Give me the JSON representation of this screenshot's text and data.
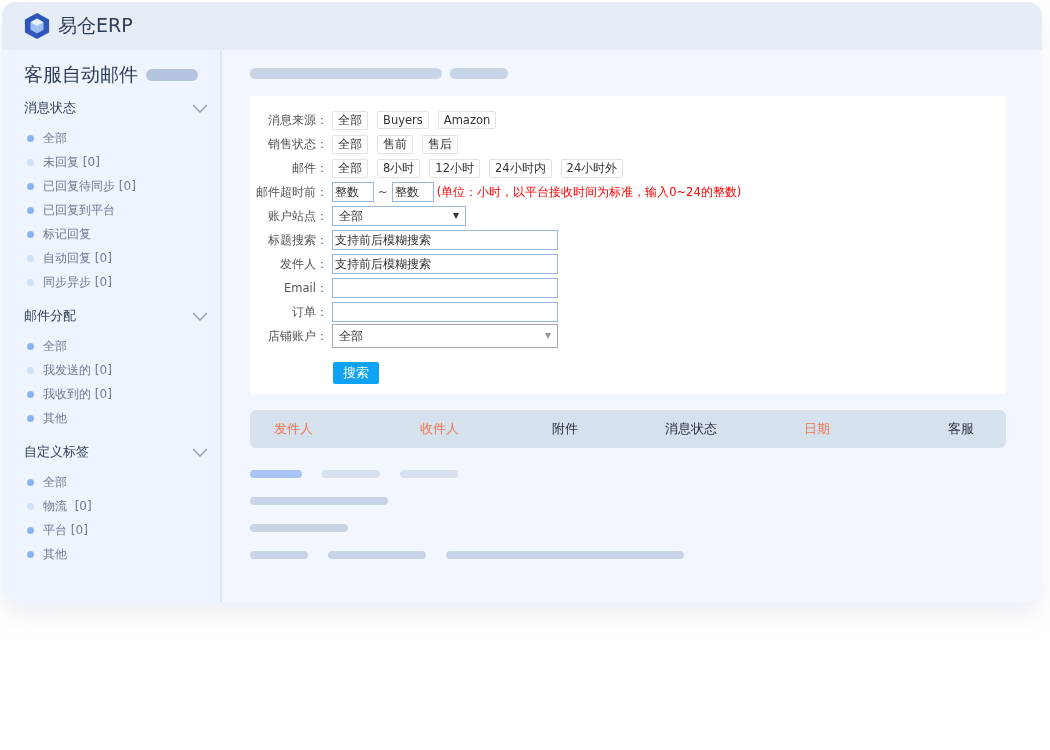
{
  "app": {
    "title": "易仓ERP"
  },
  "sidebar": {
    "title": "客服自动邮件",
    "sections": [
      {
        "title": "消息状态",
        "expanded": true,
        "items": [
          {
            "label": "全部",
            "color": "#8ab4f8"
          },
          {
            "label": "未回复 [0]",
            "color": "#cfe0fb"
          },
          {
            "label": "已回复待同步 [0]",
            "color": "#8ab4f8"
          },
          {
            "label": "已回复到平台",
            "color": "#8ab4f8"
          },
          {
            "label": "标记回复",
            "color": "#8ab4f8"
          },
          {
            "label": "自动回复 [0]",
            "color": "#cfe0fb"
          },
          {
            "label": "同步异步 [0]",
            "color": "#cfe0fb"
          }
        ]
      },
      {
        "title": "邮件分配",
        "expanded": true,
        "items": [
          {
            "label": "全部",
            "color": "#8ab4f8"
          },
          {
            "label": "我发送的 [0]",
            "color": "#cfe0fb"
          },
          {
            "label": "我收到的 [0]",
            "color": "#8ab4f8"
          },
          {
            "label": "其他",
            "color": "#8ab4f8"
          }
        ]
      },
      {
        "title": "自定义标签",
        "expanded": true,
        "items": [
          {
            "label": "全部",
            "color": "#8ab4f8"
          },
          {
            "label": "物流  [0]",
            "color": "#cfe0fb"
          },
          {
            "label": "平台 [0]",
            "color": "#8ab4f8"
          },
          {
            "label": "其他",
            "color": "#8ab4f8"
          }
        ]
      }
    ]
  },
  "filters": [
    {
      "kind": "options",
      "label": "消息来源：",
      "options": [
        "全部",
        "Buyers",
        "Amazon"
      ]
    },
    {
      "kind": "options",
      "label": "销售状态：",
      "options": [
        "全部",
        "售前",
        "售后"
      ]
    },
    {
      "kind": "options",
      "label": "邮件：",
      "options": [
        "全部",
        "8小时",
        "12小时",
        "24小时内",
        "24小时外"
      ]
    },
    {
      "kind": "range",
      "label": "邮件超时前：",
      "from": {
        "placeholder": "整数"
      },
      "separator": "~",
      "to": {
        "placeholder": "整数"
      },
      "note": "(单位：小时，以平台接收时间为标准，输入0~24的整数)"
    },
    {
      "kind": "select",
      "label": "账户站点：",
      "value": "全部"
    },
    {
      "kind": "text",
      "label": "标题搜索：",
      "placeholder": "支持前后模糊搜索"
    },
    {
      "kind": "text",
      "label": "发件人：",
      "placeholder": "支持前后模糊搜索"
    },
    {
      "kind": "text",
      "label": "Email："
    },
    {
      "kind": "text",
      "label": "订单："
    },
    {
      "kind": "wideselect",
      "label": "店铺账户：",
      "value": "全部"
    }
  ],
  "search_button": "搜索",
  "table": {
    "columns": [
      {
        "label": "发件人",
        "color": "#f5744f"
      },
      {
        "label": "收件人",
        "color": "#f5744f"
      },
      {
        "label": "附件",
        "color": "#2a2f3a"
      },
      {
        "label": "消息状态",
        "color": "#2a2f3a"
      },
      {
        "label": "日期",
        "color": "#f5744f"
      },
      {
        "label": "客服",
        "color": "#2a2f3a"
      }
    ]
  }
}
